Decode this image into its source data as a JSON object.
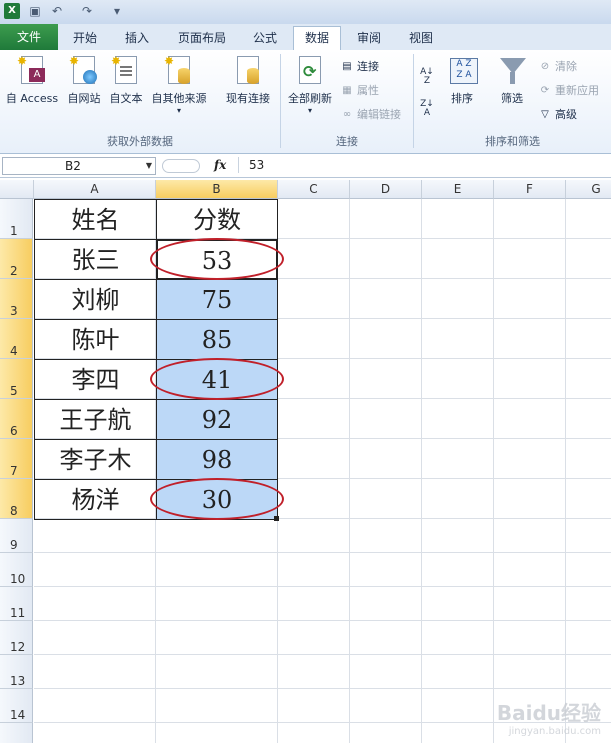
{
  "tabs": [
    "文件",
    "开始",
    "插入",
    "页面布局",
    "公式",
    "数据",
    "审阅",
    "视图"
  ],
  "active_tab": "数据",
  "ribbon": {
    "groups": [
      "获取外部数据",
      "连接",
      "排序和筛选"
    ],
    "external": [
      "自 Access",
      "自网站",
      "自文本",
      "自其他来源",
      "现有连接"
    ],
    "refresh": "全部刷新",
    "conn": [
      "连接",
      "属性",
      "编辑链接"
    ],
    "sort": "排序",
    "filter": "筛选",
    "filter_opts": [
      "清除",
      "重新应用",
      "高级"
    ]
  },
  "formula_bar": {
    "name": "B2",
    "value": "53",
    "fx": "fx"
  },
  "columns": [
    "A",
    "B",
    "C",
    "D",
    "E",
    "F",
    "G"
  ],
  "rows": [
    "1",
    "2",
    "3",
    "4",
    "5",
    "6",
    "7",
    "8",
    "9",
    "10",
    "11",
    "12",
    "13",
    "14"
  ],
  "table": {
    "headers": [
      "姓名",
      "分数"
    ],
    "names": [
      "张三",
      "刘柳",
      "陈叶",
      "李四",
      "王子航",
      "李子木",
      "杨洋"
    ],
    "scores": [
      "53",
      "75",
      "85",
      "41",
      "92",
      "98",
      "30"
    ]
  },
  "watermark": {
    "brand": "Baidu经验",
    "url": "jingyan.baidu.com"
  },
  "colors": {
    "highlight": "#bcd8f7",
    "circle": "#c0202a",
    "file_tab": "#1f7a3a"
  }
}
